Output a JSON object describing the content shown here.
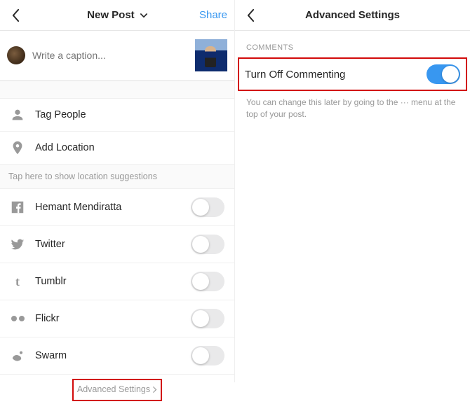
{
  "left": {
    "title": "New Post",
    "share": "Share",
    "caption_placeholder": "Write a caption...",
    "tag_people": "Tag People",
    "add_location": "Add Location",
    "location_hint": "Tap here to show location suggestions",
    "share_targets": {
      "facebook": "Hemant Mendiratta",
      "twitter": "Twitter",
      "tumblr": "Tumblr",
      "flickr": "Flickr",
      "swarm": "Swarm"
    },
    "advanced_settings": "Advanced Settings"
  },
  "right": {
    "title": "Advanced Settings",
    "section_comments": "COMMENTS",
    "turn_off_commenting": "Turn Off Commenting",
    "help_text": "You can change this later by going to the ··· menu at the top of your post."
  }
}
